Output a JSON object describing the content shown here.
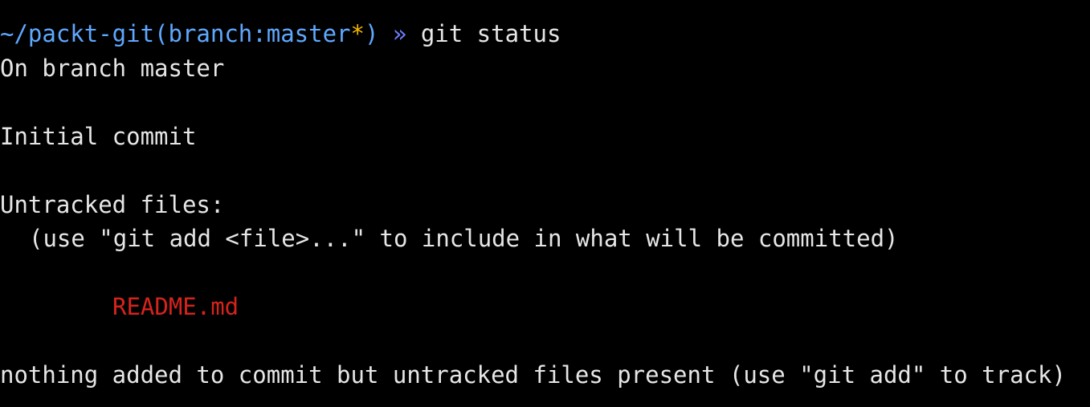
{
  "terminal": {
    "separator": "- - - - - - - - - - - - - - - - - - - - - - - - - - - - - - - - - - - - - - - - - - - - - - - - - - - - - - - - - - - - - - - - - - - - - - - - - - - - -",
    "prompt": {
      "path": "~/packt-git(branch:master",
      "dirty_marker": "*",
      "path_close": ")",
      "separator": " » ",
      "command": "git status"
    },
    "output": {
      "line1": "On branch master",
      "line2": "",
      "line3": "Initial commit",
      "line4": "",
      "line5": "Untracked files:",
      "line6": "(use \"git add <file>...\" to include in what will be committed)",
      "line7": "",
      "untracked_file": "README.md",
      "line9": "",
      "line10": "nothing added to commit but untracked files present (use \"git add\" to track)"
    },
    "colors": {
      "background": "#000000",
      "foreground": "#e6e6e6",
      "prompt_path": "#5fa8ff",
      "dirty_marker": "#f5b700",
      "prompt_separator": "#6b7dff",
      "untracked": "#d6231c"
    }
  }
}
